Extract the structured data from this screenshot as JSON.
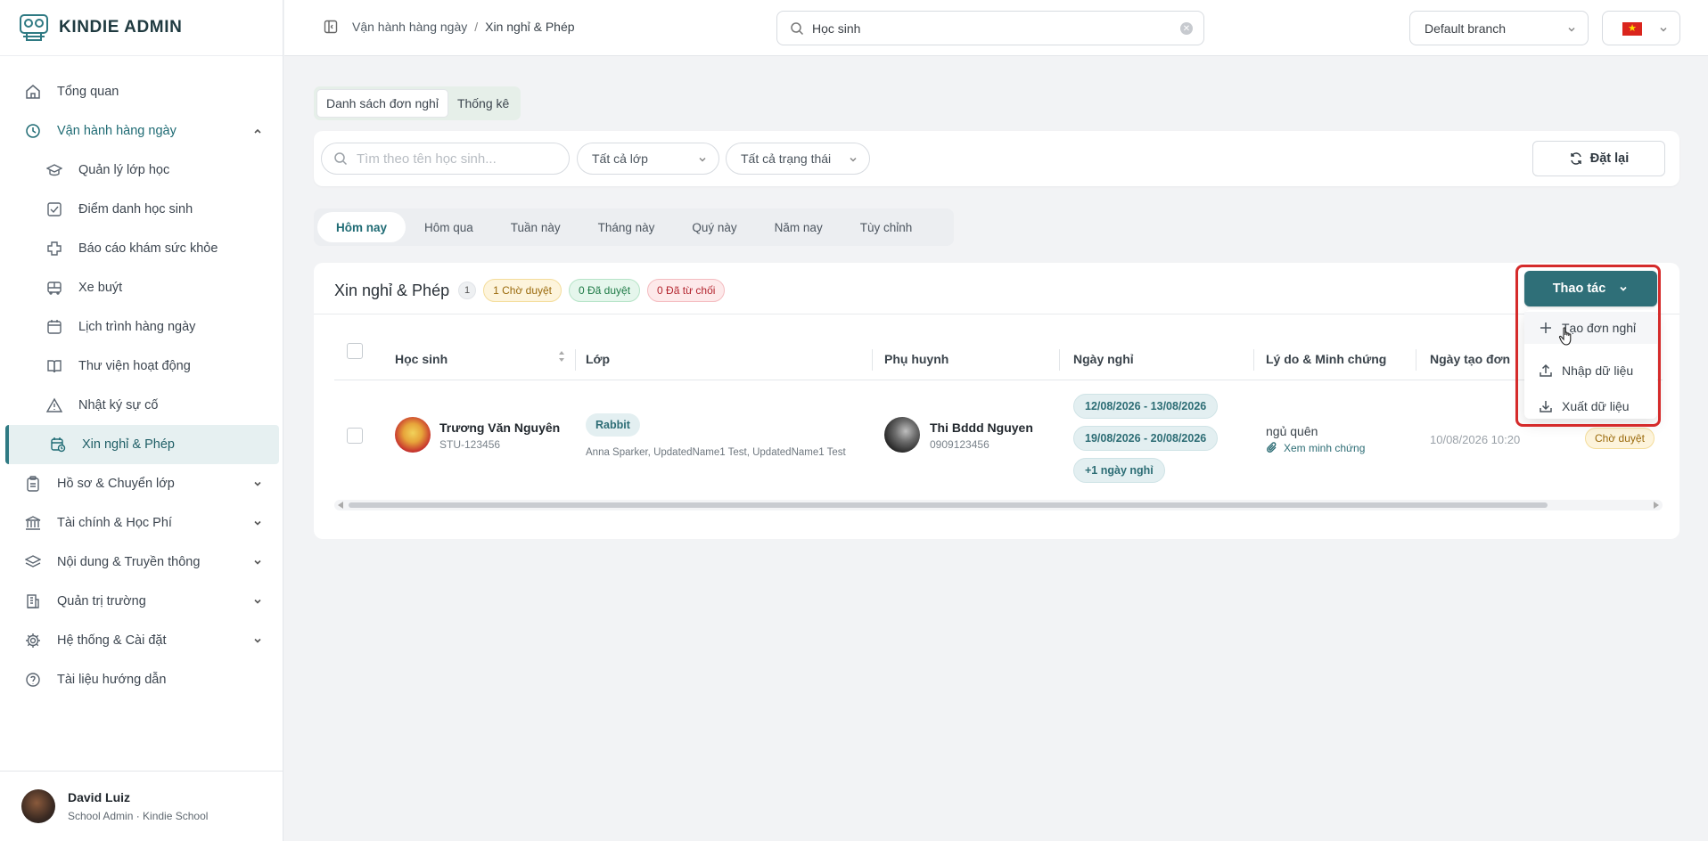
{
  "brand": {
    "name": "KINDIE ADMIN",
    "logo_icon": "owl-logo-icon"
  },
  "sidebar": {
    "items": [
      {
        "label": "Tổng quan",
        "icon": "home-icon"
      },
      {
        "label": "Vận hành hàng ngày",
        "icon": "clock-icon",
        "expanded": true,
        "children": [
          {
            "label": "Quản lý lớp học",
            "icon": "graduation-cap-icon"
          },
          {
            "label": "Điểm danh học sinh",
            "icon": "check-square-icon"
          },
          {
            "label": "Báo cáo khám sức khỏe",
            "icon": "health-cross-icon"
          },
          {
            "label": "Xe buýt",
            "icon": "bus-icon"
          },
          {
            "label": "Lịch trình hàng ngày",
            "icon": "calendar-icon"
          },
          {
            "label": "Thư viện hoạt động",
            "icon": "book-icon"
          },
          {
            "label": "Nhật ký sự cố",
            "icon": "warning-icon"
          },
          {
            "label": "Xin nghỉ & Phép",
            "icon": "calendar-clock-icon",
            "active": true
          }
        ]
      },
      {
        "label": "Hồ sơ & Chuyển lớp",
        "icon": "clipboard-icon"
      },
      {
        "label": "Tài chính & Học Phí",
        "icon": "bank-icon"
      },
      {
        "label": "Nội dung & Truyền thông",
        "icon": "layers-icon"
      },
      {
        "label": "Quản trị trường",
        "icon": "building-icon"
      },
      {
        "label": "Hệ thống & Cài đặt",
        "icon": "gear-icon"
      },
      {
        "label": "Tài liệu hướng dẫn",
        "icon": "help-circle-icon"
      }
    ]
  },
  "user": {
    "name": "David Luiz",
    "role": "School Admin · Kindie School"
  },
  "topbar": {
    "breadcrumb": [
      "Vận hành hàng ngày",
      "Xin nghỉ & Phép"
    ],
    "search_value": "Học sinh",
    "branch": "Default branch",
    "language_flag": "vietnam-flag-icon"
  },
  "view_tabs": [
    "Danh sách đơn nghỉ",
    "Thống kê"
  ],
  "filters": {
    "search_placeholder": "Tìm theo tên học sinh...",
    "class_select": "Tất cả lớp",
    "status_select": "Tất cả trạng thái",
    "reset_label": "Đặt lại"
  },
  "range_tabs": [
    "Hôm nay",
    "Hôm qua",
    "Tuần này",
    "Tháng này",
    "Quý này",
    "Năm nay",
    "Tùy chỉnh"
  ],
  "list": {
    "title": "Xin nghỉ & Phép",
    "count": "1",
    "badges": {
      "pending": "1 Chờ duyệt",
      "approved": "0 Đã duyệt",
      "rejected": "0 Đã từ chối"
    },
    "columns": [
      "Học sinh",
      "Lớp",
      "Phụ huynh",
      "Ngày nghỉ",
      "Lý do & Minh chứng",
      "Ngày tạo đơn"
    ],
    "rows": [
      {
        "student_name": "Trương Văn Nguyên",
        "student_id": "STU-123456",
        "class": "Rabbit",
        "teachers": "Anna Sparker, UpdatedName1 Test, UpdatedName1 Test",
        "parent_name": "Thi Bddd Nguyen",
        "parent_phone": "0909123456",
        "dates": [
          "12/08/2026 - 13/08/2026",
          "19/08/2026 - 20/08/2026",
          "+1 ngày nghỉ"
        ],
        "reason": "ngủ quên",
        "evidence": "Xem minh chứng",
        "created": "10/08/2026 10:20",
        "status": "Chờ duyệt"
      }
    ]
  },
  "actions": {
    "button": "Thao tác",
    "menu": [
      {
        "label": "Tạo đơn nghỉ",
        "icon": "plus-icon"
      },
      {
        "label": "Nhập dữ liệu",
        "icon": "upload-icon"
      },
      {
        "label": "Xuất dữ liệu",
        "icon": "download-icon"
      }
    ]
  },
  "colors": {
    "accent": "#2f6f78",
    "highlight": "#d52b2b"
  }
}
